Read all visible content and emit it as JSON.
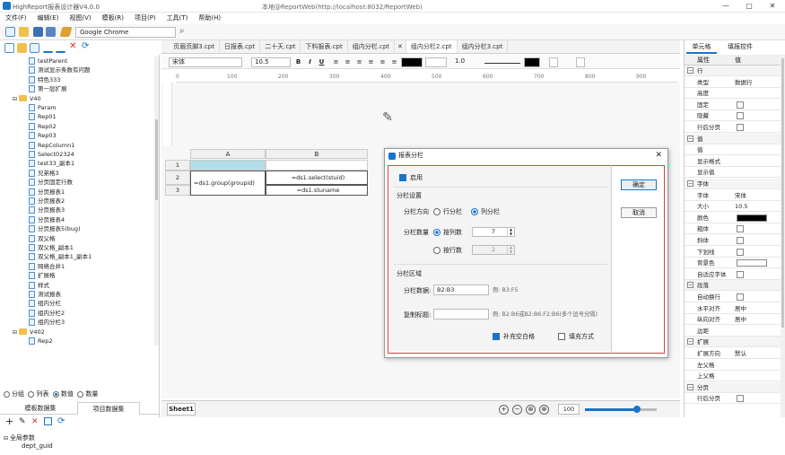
{
  "app": {
    "name": "HighReport报表设计器V4.0.0",
    "window_title": "本地@ReportWeb(http://localhost:8032/ReportWeb)",
    "win_buttons": [
      "—",
      "▢",
      "✕"
    ]
  },
  "menu": [
    "文件(F)",
    "编辑(E)",
    "视图(V)",
    "模板(R)",
    "项目(P)",
    "工具(T)",
    "帮助(H)"
  ],
  "toolbar": {
    "browser": "Google Chrome"
  },
  "tree": [
    {
      "label": "testParent",
      "level": 2,
      "type": "file"
    },
    {
      "label": "测试显示条数有问题",
      "level": 2,
      "type": "file"
    },
    {
      "label": "特色333",
      "level": 2,
      "type": "file"
    },
    {
      "label": "第一层扩展",
      "level": 2,
      "type": "file"
    },
    {
      "label": "V40",
      "level": 1,
      "type": "folder"
    },
    {
      "label": "Param",
      "level": 2,
      "type": "file"
    },
    {
      "label": "Rep01",
      "level": 2,
      "type": "file"
    },
    {
      "label": "Rep02",
      "level": 2,
      "type": "file"
    },
    {
      "label": "Rep03",
      "level": 2,
      "type": "file"
    },
    {
      "label": "RepColumn1",
      "level": 2,
      "type": "file"
    },
    {
      "label": "Select02324",
      "level": 2,
      "type": "file"
    },
    {
      "label": "test33_副本1",
      "level": 2,
      "type": "file"
    },
    {
      "label": "兄弟格3",
      "level": 2,
      "type": "file"
    },
    {
      "label": "分页固定行数",
      "level": 2,
      "type": "file"
    },
    {
      "label": "分页报表1",
      "level": 2,
      "type": "file"
    },
    {
      "label": "分页报表2",
      "level": 2,
      "type": "file"
    },
    {
      "label": "分页报表3",
      "level": 2,
      "type": "file"
    },
    {
      "label": "分页报表4",
      "level": 2,
      "type": "file"
    },
    {
      "label": "分页报表5(bug)",
      "level": 2,
      "type": "file"
    },
    {
      "label": "双父格",
      "level": 2,
      "type": "file"
    },
    {
      "label": "双父格_副本1",
      "level": 2,
      "type": "file"
    },
    {
      "label": "双父格_副本1_副本1",
      "level": 2,
      "type": "file"
    },
    {
      "label": "网络合并1",
      "level": 2,
      "type": "file"
    },
    {
      "label": "扩展格",
      "level": 2,
      "type": "file"
    },
    {
      "label": "样式",
      "level": 2,
      "type": "file"
    },
    {
      "label": "测试报表",
      "level": 2,
      "type": "file"
    },
    {
      "label": "组内分栏",
      "level": 2,
      "type": "file"
    },
    {
      "label": "组内分栏2",
      "level": 2,
      "type": "file"
    },
    {
      "label": "组内分栏3",
      "level": 2,
      "type": "file"
    },
    {
      "label": "V402",
      "level": 1,
      "type": "folder"
    },
    {
      "label": "Rep2",
      "level": 2,
      "type": "file"
    }
  ],
  "view_modes": {
    "options": [
      "分组",
      "列表",
      "数值",
      "数量"
    ],
    "selected": "数值"
  },
  "dataset_tabs": [
    "模板数据集",
    "项目数据集"
  ],
  "params": {
    "root": "全局参数",
    "child": "dept_guid"
  },
  "doc_tabs": [
    {
      "label": "页眉页脚3.cpt",
      "active": false
    },
    {
      "label": "日报表.cpt",
      "active": false
    },
    {
      "label": "二十天.cpt",
      "active": false
    },
    {
      "label": "下料报表.cpt",
      "active": false
    },
    {
      "label": "组内分栏.cpt",
      "active": false
    },
    {
      "label": "组内分栏2.cpt",
      "active": true
    },
    {
      "label": "组内分栏3.cpt",
      "active": false
    }
  ],
  "format": {
    "font": "宋体",
    "size": "10.5",
    "line_width": "1.0",
    "bold": "B",
    "italic": "I",
    "underline": "U"
  },
  "ruler": [
    "0",
    "100",
    "200",
    "300",
    "400",
    "500",
    "600",
    "700",
    "800",
    "900"
  ],
  "grid": {
    "cols": [
      "A",
      "B"
    ],
    "rows": [
      "1",
      "2",
      "3"
    ],
    "c_a2": "=ds1.group(groupid)",
    "c_b2": "=ds1.select(stuid)",
    "c_b3": "=ds1.stuname"
  },
  "sheet": "Sheet1",
  "zoom": {
    "value": "100",
    "level": 0.72
  },
  "right_tabs": [
    "单元格",
    "填报控件"
  ],
  "props": {
    "col1": "属性",
    "col2": "值"
  },
  "prop_rows": [
    {
      "k": "行",
      "group": true
    },
    {
      "k": "类型",
      "v": "数据行"
    },
    {
      "k": "高度",
      "v": ""
    },
    {
      "k": "固定",
      "chk": true
    },
    {
      "k": "隐藏",
      "chk": true
    },
    {
      "k": "行后分页",
      "chk": true
    },
    {
      "k": "值",
      "group": true
    },
    {
      "k": "值",
      "v": ""
    },
    {
      "k": "显示格式",
      "v": ""
    },
    {
      "k": "显示值",
      "v": ""
    },
    {
      "k": "字体",
      "group": true
    },
    {
      "k": "字体",
      "v": "宋体"
    },
    {
      "k": "大小",
      "v": "10.5"
    },
    {
      "k": "颜色",
      "swatch": "#000000"
    },
    {
      "k": "粗体",
      "chk": true
    },
    {
      "k": "斜体",
      "chk": true
    },
    {
      "k": "下划线",
      "chk": true
    },
    {
      "k": "背景色",
      "swatch": "#ffffff"
    },
    {
      "k": "自适应字体",
      "chk": true
    },
    {
      "k": "段落",
      "group": true
    },
    {
      "k": "自动换行",
      "chk": true
    },
    {
      "k": "水平对齐",
      "v": "居中"
    },
    {
      "k": "纵向对齐",
      "v": "居中"
    },
    {
      "k": "边距",
      "v": ""
    },
    {
      "k": "扩展",
      "group": true
    },
    {
      "k": "扩展方向",
      "v": "默认"
    },
    {
      "k": "左父格",
      "v": ""
    },
    {
      "k": "上父格",
      "v": ""
    },
    {
      "k": "分页",
      "group": true
    },
    {
      "k": "行后分页",
      "chk": true
    }
  ],
  "dialog": {
    "title": "报表分栏",
    "close": "✕",
    "enable": "启用",
    "section1": "分栏设置",
    "direction_label": "分栏方向",
    "dir_row": "行分栏",
    "dir_col": "列分栏",
    "count_label": "分栏数量",
    "by_cols": "按列数",
    "cols_value": "7",
    "by_rows": "按行数",
    "rows_value": "2",
    "section2": "分栏区域",
    "data_label": "分栏数据:",
    "data_value": "B2:B3",
    "data_hint": "例: B3:F5",
    "copy_label": "复制标题:",
    "copy_value": "",
    "copy_hint": "例: B2:B6或B2:B6,F2:B6(多个逗号分隔)",
    "fill_blank": "补充空白格",
    "fill_mode": "填充方式",
    "ok": "确定",
    "cancel": "取消"
  }
}
